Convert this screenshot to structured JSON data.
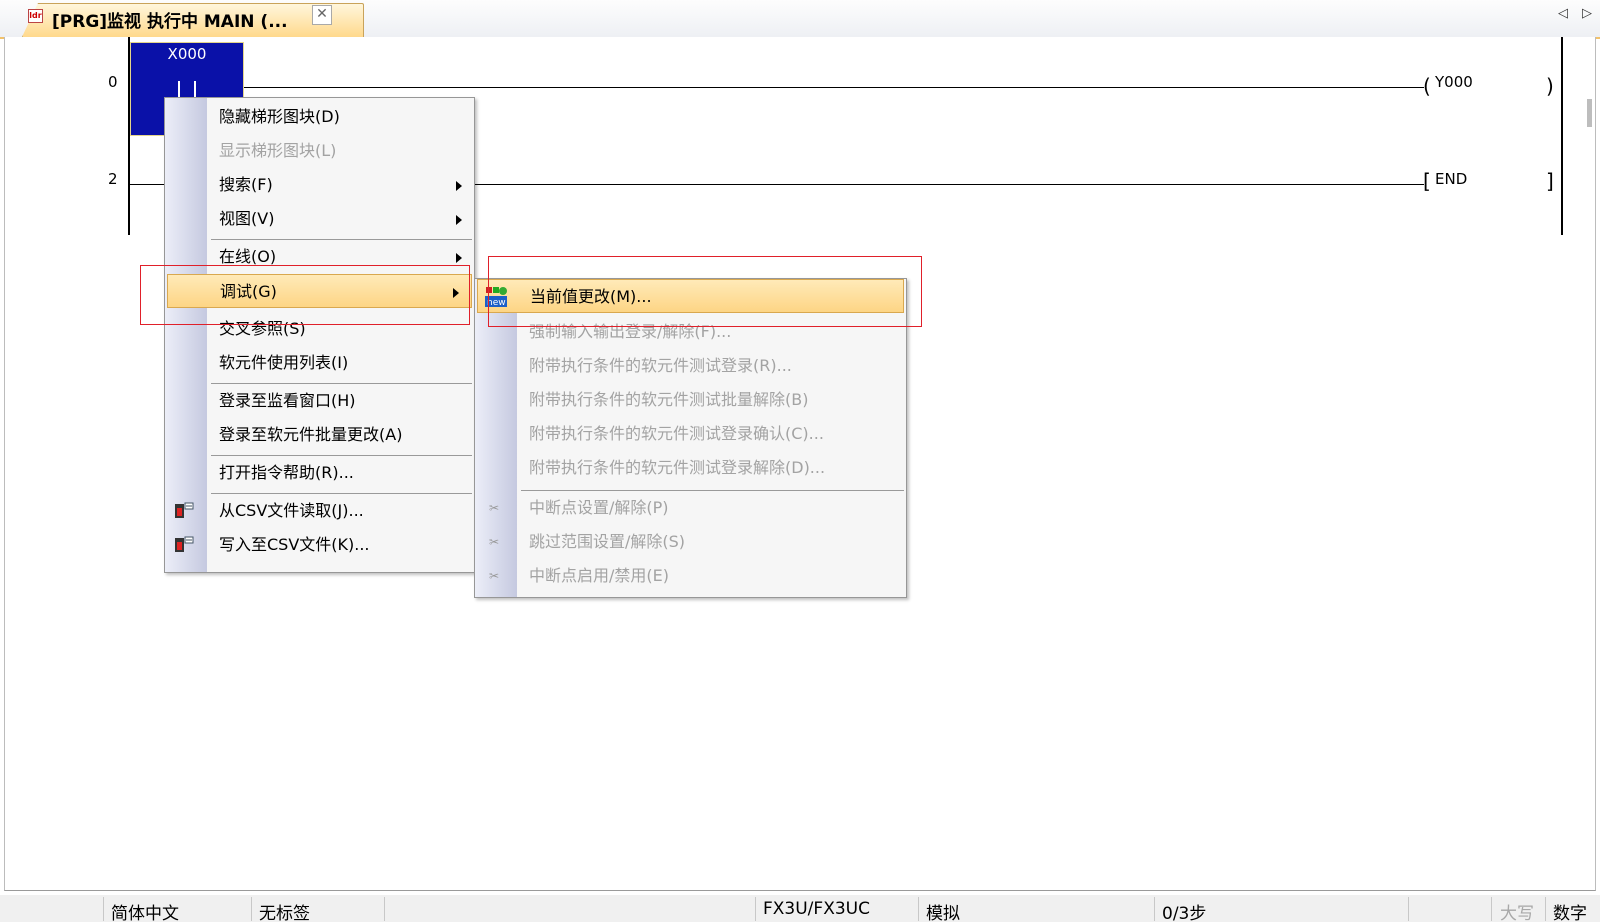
{
  "tab": {
    "icon": "ladder-program-icon",
    "title": "[PRG]监视 执行中 MAIN (...",
    "close": "✕",
    "nav_left": "◁",
    "nav_right": "▷"
  },
  "ladder": {
    "rungs": [
      {
        "step": "0",
        "contact": "X000",
        "coil": "Y000",
        "coil_open": "(",
        "coil_close": ")"
      },
      {
        "step": "2",
        "instruction": "END",
        "instr_open": "[",
        "instr_close": "]"
      }
    ]
  },
  "context_menu": {
    "items": [
      {
        "label": "隐藏梯形图块(D)",
        "enabled": true
      },
      {
        "label": "显示梯形图块(L)",
        "enabled": false
      },
      {
        "label": "搜索(F)",
        "enabled": true,
        "submenu": true
      },
      {
        "label": "视图(V)",
        "enabled": true,
        "submenu": true
      },
      {
        "label": "在线(O)",
        "enabled": true,
        "submenu": true
      },
      {
        "label": "调试(G)",
        "enabled": true,
        "submenu": true,
        "highlighted": true
      },
      {
        "label": "交叉参照(S)",
        "enabled": true
      },
      {
        "label": "软元件使用列表(I)",
        "enabled": true
      },
      {
        "label": "登录至监看窗口(H)",
        "enabled": true
      },
      {
        "label": "登录至软元件批量更改(A)",
        "enabled": true
      },
      {
        "label": "打开指令帮助(R)...",
        "enabled": true
      },
      {
        "label": "从CSV文件读取(J)...",
        "enabled": true,
        "icon": "csv-read-icon"
      },
      {
        "label": "写入至CSV文件(K)...",
        "enabled": true,
        "icon": "csv-write-icon"
      }
    ]
  },
  "debug_submenu": {
    "items": [
      {
        "label": "当前值更改(M)...",
        "enabled": true,
        "highlighted": true,
        "icon": "modify-value-icon"
      },
      {
        "label": "强制输入输出登录/解除(F)...",
        "enabled": false
      },
      {
        "label": "附带执行条件的软元件测试登录(R)...",
        "enabled": false
      },
      {
        "label": "附带执行条件的软元件测试批量解除(B)",
        "enabled": false
      },
      {
        "label": "附带执行条件的软元件测试登录确认(C)...",
        "enabled": false
      },
      {
        "label": "附带执行条件的软元件测试登录解除(D)...",
        "enabled": false
      },
      {
        "label": "中断点设置/解除(P)",
        "enabled": false,
        "icon": "breakpoint-icon"
      },
      {
        "label": "跳过范围设置/解除(S)",
        "enabled": false,
        "icon": "skip-range-icon"
      },
      {
        "label": "中断点启用/禁用(E)",
        "enabled": false,
        "icon": "breakpoint-toggle-icon"
      }
    ]
  },
  "status_bar": {
    "language": "简体中文",
    "label": "无标签",
    "plc": "FX3U/FX3UC",
    "mode": "模拟",
    "steps": "0/3步",
    "caps": "大写",
    "num": "数字"
  },
  "colors": {
    "selection": "#0a11a8",
    "menu_highlight": "#fdd585",
    "annotation": "#e0202a",
    "tab_active": "#ffd98c"
  }
}
